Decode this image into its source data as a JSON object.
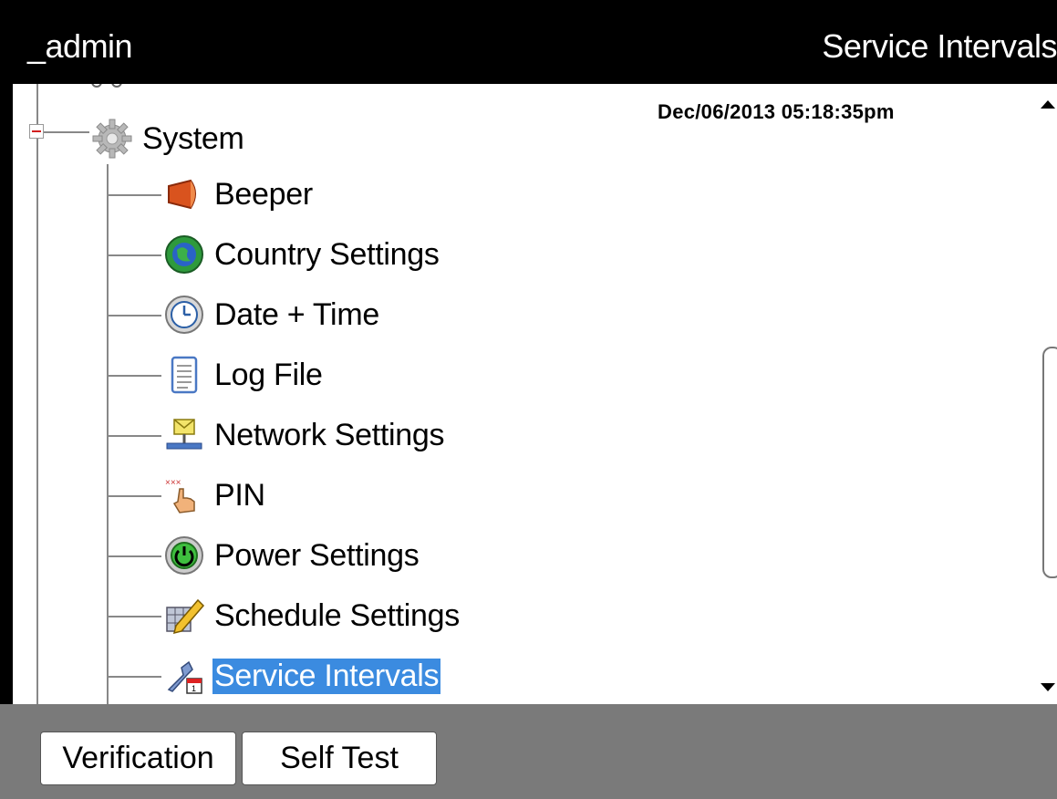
{
  "header": {
    "user": "_admin",
    "screen_title": "Service Intervals"
  },
  "timestamp": "Dec/06/2013 05:18:35pm",
  "tree": {
    "parent": {
      "label": "System",
      "icon": "gear-icon",
      "expanded": true
    },
    "children": [
      {
        "label": "Beeper",
        "icon": "beeper-icon"
      },
      {
        "label": "Country Settings",
        "icon": "globe-icon"
      },
      {
        "label": "Date + Time",
        "icon": "clock-icon"
      },
      {
        "label": "Log File",
        "icon": "notepad-icon"
      },
      {
        "label": "Network Settings",
        "icon": "network-icon"
      },
      {
        "label": "PIN",
        "icon": "hand-pointer-icon"
      },
      {
        "label": "Power Settings",
        "icon": "power-icon"
      },
      {
        "label": "Schedule Settings",
        "icon": "schedule-pencil-icon"
      },
      {
        "label": "Service Intervals",
        "icon": "wrench-calendar-icon",
        "selected": true
      }
    ]
  },
  "buttons": {
    "verification": "Verification",
    "self_test": "Self Test"
  },
  "colors": {
    "selection": "#3b8be0",
    "header_bg": "#000000",
    "footer_bg": "#7a7a7a"
  }
}
